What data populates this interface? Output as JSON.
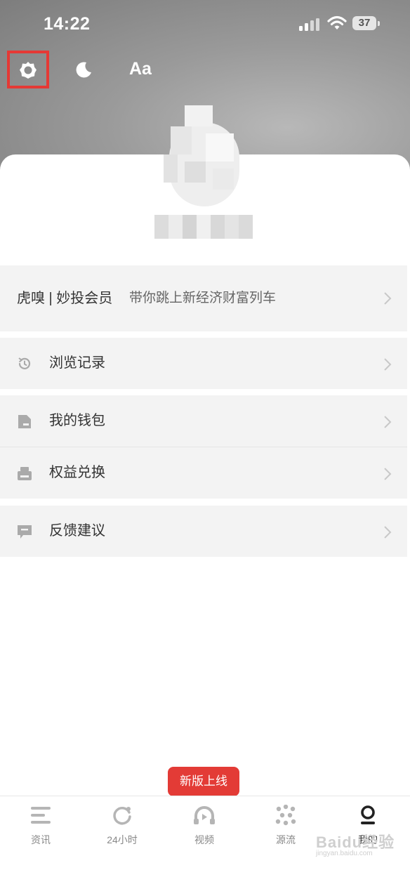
{
  "status_bar": {
    "time": "14:22",
    "battery": "37"
  },
  "toolbar": {
    "font_label": "Aa"
  },
  "member_banner": {
    "title": "虎嗅 | 妙投会员",
    "subtitle": "带你跳上新经济财富列车"
  },
  "menu": [
    {
      "label": "浏览记录",
      "icon": "history-icon"
    },
    {
      "label": "我的钱包",
      "icon": "wallet-icon"
    },
    {
      "label": "权益兑换",
      "icon": "redeem-icon"
    },
    {
      "label": "反馈建议",
      "icon": "feedback-icon"
    }
  ],
  "badge": {
    "text": "新版上线"
  },
  "tabs": [
    {
      "label": "资讯",
      "icon": "news-icon"
    },
    {
      "label": "24小时",
      "icon": "refresh-icon"
    },
    {
      "label": "视频",
      "icon": "video-icon"
    },
    {
      "label": "源流",
      "icon": "source-icon"
    },
    {
      "label": "我的",
      "icon": "profile-icon",
      "active": true
    }
  ],
  "watermark": {
    "brand": "Baidu经验",
    "url": "jingyan.baidu.com"
  },
  "colors": {
    "accent": "#e33b36",
    "highlight_box": "#e53935",
    "list_bg": "#f3f3f3",
    "header_bg": "#9a9a9a"
  }
}
